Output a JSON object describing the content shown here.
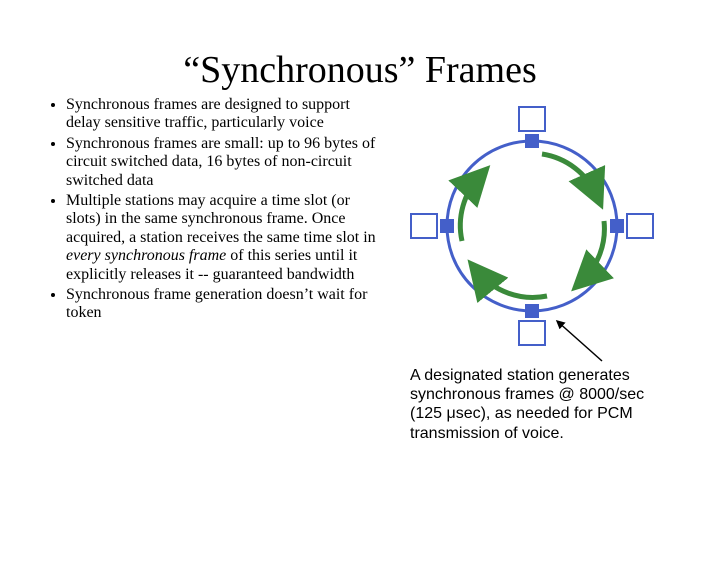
{
  "title": "“Synchronous” Frames",
  "bullets": {
    "b1": "Synchronous frames are designed to support delay sensitive traffic, particularly voice",
    "b2": "Synchronous frames are small: up to 96 bytes of circuit switched data, 16 bytes of non-circuit switched data",
    "b3_prefix": "Multiple stations may acquire a time slot (or slots) in the same synchronous frame.  Once acquired, a station receives the same time slot in ",
    "b3_em": "every synchronous frame",
    "b3_suffix": " of this series until it explicitly releases it -- guaranteed bandwidth",
    "b4": "Synchronous frame generation doesn’t wait for token"
  },
  "diagram": {
    "nodes": [
      "top",
      "right",
      "bottom",
      "left"
    ],
    "arrows_direction": "clockwise",
    "pointer_target": "bottom-node"
  },
  "caption": "A designated station generates synchronous frames @ 8000/sec (125 μsec), as needed for PCM transmission of voice."
}
